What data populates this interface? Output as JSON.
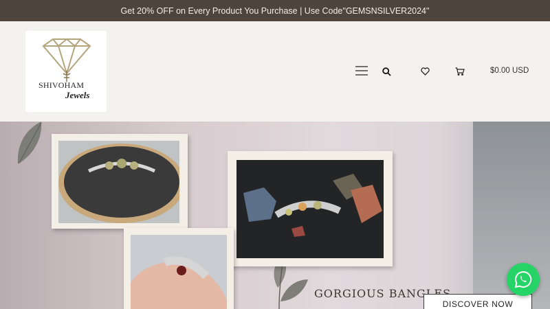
{
  "announcement": {
    "text": "Get 20% OFF on Every Product You Purchase | Use Code\"GEMSNSILVER2024\""
  },
  "header": {
    "logo": {
      "line1": "SHIVOHAM",
      "line2": "Jewels"
    },
    "icons": [
      "menu-icon",
      "search-icon",
      "heart-icon",
      "cart-icon"
    ],
    "cart_total": "$0.00 USD"
  },
  "hero": {
    "caption": "GORGIOUS BANGLES",
    "cta_label": "DISCOVER NOW"
  },
  "colors": {
    "announcement_bg": "#4e443c",
    "whatsapp": "#25d366"
  }
}
